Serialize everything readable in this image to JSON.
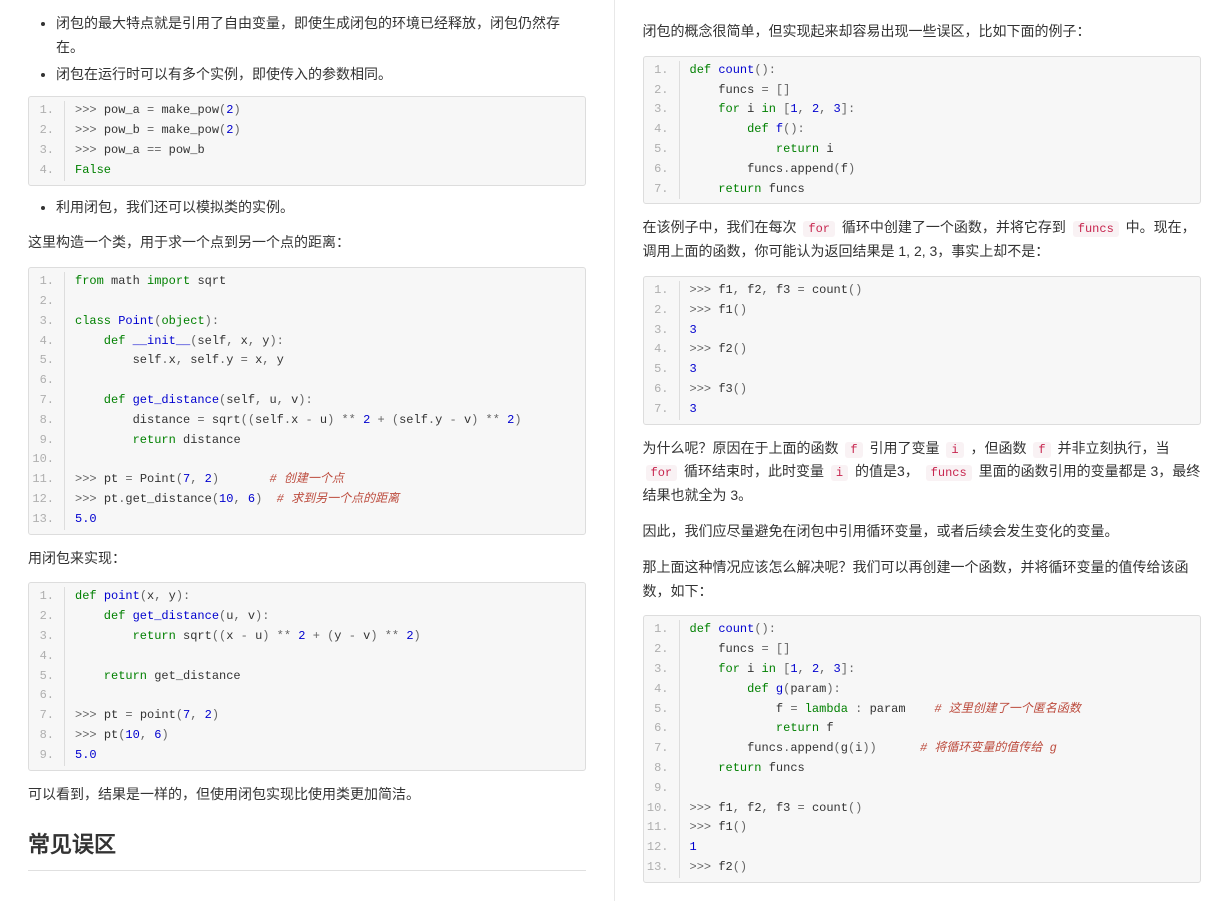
{
  "left": {
    "bullets": [
      "闭包的最大特点就是引用了自由变量，即使生成闭包的环境已经释放，闭包仍然存在。",
      "闭包在运行时可以有多个实例，即使传入的参数相同。"
    ],
    "code1": [
      [
        {
          "t": ">>> ",
          "c": "pr"
        },
        {
          "t": "pow_a ",
          "c": "nm"
        },
        {
          "t": "= ",
          "c": "op"
        },
        {
          "t": "make_pow",
          "c": "nm"
        },
        {
          "t": "(",
          "c": "op"
        },
        {
          "t": "2",
          "c": "num"
        },
        {
          "t": ")",
          "c": "op"
        }
      ],
      [
        {
          "t": ">>> ",
          "c": "pr"
        },
        {
          "t": "pow_b ",
          "c": "nm"
        },
        {
          "t": "= ",
          "c": "op"
        },
        {
          "t": "make_pow",
          "c": "nm"
        },
        {
          "t": "(",
          "c": "op"
        },
        {
          "t": "2",
          "c": "num"
        },
        {
          "t": ")",
          "c": "op"
        }
      ],
      [
        {
          "t": ">>> ",
          "c": "pr"
        },
        {
          "t": "pow_a ",
          "c": "nm"
        },
        {
          "t": "== ",
          "c": "op"
        },
        {
          "t": "pow_b",
          "c": "nm"
        }
      ],
      [
        {
          "t": "False",
          "c": "kw"
        }
      ]
    ],
    "bullets2": [
      "利用闭包，我们还可以模拟类的实例。"
    ],
    "p1": "这里构造一个类，用于求一个点到另一个点的距离：",
    "code2": [
      [
        {
          "t": "from ",
          "c": "kw"
        },
        {
          "t": "math ",
          "c": "nm"
        },
        {
          "t": "import ",
          "c": "kw"
        },
        {
          "t": "sqrt",
          "c": "nm"
        }
      ],
      [
        {
          "t": "",
          "c": "nm"
        }
      ],
      [
        {
          "t": "class ",
          "c": "kw"
        },
        {
          "t": "Point",
          "c": "fn"
        },
        {
          "t": "(",
          "c": "op"
        },
        {
          "t": "object",
          "c": "bi"
        },
        {
          "t": "):",
          "c": "op"
        }
      ],
      [
        {
          "t": "    def ",
          "c": "kw"
        },
        {
          "t": "__init__",
          "c": "fn"
        },
        {
          "t": "(",
          "c": "op"
        },
        {
          "t": "self",
          "c": "nm"
        },
        {
          "t": ", ",
          "c": "op"
        },
        {
          "t": "x",
          "c": "nm"
        },
        {
          "t": ", ",
          "c": "op"
        },
        {
          "t": "y",
          "c": "nm"
        },
        {
          "t": "):",
          "c": "op"
        }
      ],
      [
        {
          "t": "        self",
          "c": "nm"
        },
        {
          "t": ".",
          "c": "op"
        },
        {
          "t": "x",
          "c": "nm"
        },
        {
          "t": ", ",
          "c": "op"
        },
        {
          "t": "self",
          "c": "nm"
        },
        {
          "t": ".",
          "c": "op"
        },
        {
          "t": "y ",
          "c": "nm"
        },
        {
          "t": "= ",
          "c": "op"
        },
        {
          "t": "x",
          "c": "nm"
        },
        {
          "t": ", ",
          "c": "op"
        },
        {
          "t": "y",
          "c": "nm"
        }
      ],
      [
        {
          "t": "",
          "c": "nm"
        }
      ],
      [
        {
          "t": "    def ",
          "c": "kw"
        },
        {
          "t": "get_distance",
          "c": "fn"
        },
        {
          "t": "(",
          "c": "op"
        },
        {
          "t": "self",
          "c": "nm"
        },
        {
          "t": ", ",
          "c": "op"
        },
        {
          "t": "u",
          "c": "nm"
        },
        {
          "t": ", ",
          "c": "op"
        },
        {
          "t": "v",
          "c": "nm"
        },
        {
          "t": "):",
          "c": "op"
        }
      ],
      [
        {
          "t": "        distance ",
          "c": "nm"
        },
        {
          "t": "= ",
          "c": "op"
        },
        {
          "t": "sqrt",
          "c": "nm"
        },
        {
          "t": "((",
          "c": "op"
        },
        {
          "t": "self",
          "c": "nm"
        },
        {
          "t": ".",
          "c": "op"
        },
        {
          "t": "x ",
          "c": "nm"
        },
        {
          "t": "- ",
          "c": "op"
        },
        {
          "t": "u",
          "c": "nm"
        },
        {
          "t": ") ",
          "c": "op"
        },
        {
          "t": "** ",
          "c": "op"
        },
        {
          "t": "2 ",
          "c": "num"
        },
        {
          "t": "+ (",
          "c": "op"
        },
        {
          "t": "self",
          "c": "nm"
        },
        {
          "t": ".",
          "c": "op"
        },
        {
          "t": "y ",
          "c": "nm"
        },
        {
          "t": "- ",
          "c": "op"
        },
        {
          "t": "v",
          "c": "nm"
        },
        {
          "t": ") ",
          "c": "op"
        },
        {
          "t": "** ",
          "c": "op"
        },
        {
          "t": "2",
          "c": "num"
        },
        {
          "t": ")",
          "c": "op"
        }
      ],
      [
        {
          "t": "        return ",
          "c": "kw"
        },
        {
          "t": "distance",
          "c": "nm"
        }
      ],
      [
        {
          "t": "",
          "c": "nm"
        }
      ],
      [
        {
          "t": ">>> ",
          "c": "pr"
        },
        {
          "t": "pt ",
          "c": "nm"
        },
        {
          "t": "= ",
          "c": "op"
        },
        {
          "t": "Point",
          "c": "nm"
        },
        {
          "t": "(",
          "c": "op"
        },
        {
          "t": "7",
          "c": "num"
        },
        {
          "t": ", ",
          "c": "op"
        },
        {
          "t": "2",
          "c": "num"
        },
        {
          "t": ")       ",
          "c": "op"
        },
        {
          "t": "# 创建一个点",
          "c": "cmt"
        }
      ],
      [
        {
          "t": ">>> ",
          "c": "pr"
        },
        {
          "t": "pt",
          "c": "nm"
        },
        {
          "t": ".",
          "c": "op"
        },
        {
          "t": "get_distance",
          "c": "nm"
        },
        {
          "t": "(",
          "c": "op"
        },
        {
          "t": "10",
          "c": "num"
        },
        {
          "t": ", ",
          "c": "op"
        },
        {
          "t": "6",
          "c": "num"
        },
        {
          "t": ")  ",
          "c": "op"
        },
        {
          "t": "# 求到另一个点的距离",
          "c": "cmt"
        }
      ],
      [
        {
          "t": "5.0",
          "c": "num"
        }
      ]
    ],
    "p2": "用闭包来实现：",
    "code3": [
      [
        {
          "t": "def ",
          "c": "kw"
        },
        {
          "t": "point",
          "c": "fn"
        },
        {
          "t": "(",
          "c": "op"
        },
        {
          "t": "x",
          "c": "nm"
        },
        {
          "t": ", ",
          "c": "op"
        },
        {
          "t": "y",
          "c": "nm"
        },
        {
          "t": "):",
          "c": "op"
        }
      ],
      [
        {
          "t": "    def ",
          "c": "kw"
        },
        {
          "t": "get_distance",
          "c": "fn"
        },
        {
          "t": "(",
          "c": "op"
        },
        {
          "t": "u",
          "c": "nm"
        },
        {
          "t": ", ",
          "c": "op"
        },
        {
          "t": "v",
          "c": "nm"
        },
        {
          "t": "):",
          "c": "op"
        }
      ],
      [
        {
          "t": "        return ",
          "c": "kw"
        },
        {
          "t": "sqrt",
          "c": "nm"
        },
        {
          "t": "((",
          "c": "op"
        },
        {
          "t": "x ",
          "c": "nm"
        },
        {
          "t": "- ",
          "c": "op"
        },
        {
          "t": "u",
          "c": "nm"
        },
        {
          "t": ") ",
          "c": "op"
        },
        {
          "t": "** ",
          "c": "op"
        },
        {
          "t": "2 ",
          "c": "num"
        },
        {
          "t": "+ (",
          "c": "op"
        },
        {
          "t": "y ",
          "c": "nm"
        },
        {
          "t": "- ",
          "c": "op"
        },
        {
          "t": "v",
          "c": "nm"
        },
        {
          "t": ") ",
          "c": "op"
        },
        {
          "t": "** ",
          "c": "op"
        },
        {
          "t": "2",
          "c": "num"
        },
        {
          "t": ")",
          "c": "op"
        }
      ],
      [
        {
          "t": "",
          "c": "nm"
        }
      ],
      [
        {
          "t": "    return ",
          "c": "kw"
        },
        {
          "t": "get_distance",
          "c": "nm"
        }
      ],
      [
        {
          "t": "",
          "c": "nm"
        }
      ],
      [
        {
          "t": ">>> ",
          "c": "pr"
        },
        {
          "t": "pt ",
          "c": "nm"
        },
        {
          "t": "= ",
          "c": "op"
        },
        {
          "t": "point",
          "c": "nm"
        },
        {
          "t": "(",
          "c": "op"
        },
        {
          "t": "7",
          "c": "num"
        },
        {
          "t": ", ",
          "c": "op"
        },
        {
          "t": "2",
          "c": "num"
        },
        {
          "t": ")",
          "c": "op"
        }
      ],
      [
        {
          "t": ">>> ",
          "c": "pr"
        },
        {
          "t": "pt",
          "c": "nm"
        },
        {
          "t": "(",
          "c": "op"
        },
        {
          "t": "10",
          "c": "num"
        },
        {
          "t": ", ",
          "c": "op"
        },
        {
          "t": "6",
          "c": "num"
        },
        {
          "t": ")",
          "c": "op"
        }
      ],
      [
        {
          "t": "5.0",
          "c": "num"
        }
      ]
    ],
    "p3": "可以看到，结果是一样的，但使用闭包实现比使用类更加简洁。",
    "h2": "常见误区"
  },
  "right": {
    "p1": "闭包的概念很简单，但实现起来却容易出现一些误区，比如下面的例子：",
    "code1": [
      [
        {
          "t": "def ",
          "c": "kw"
        },
        {
          "t": "count",
          "c": "fn"
        },
        {
          "t": "():",
          "c": "op"
        }
      ],
      [
        {
          "t": "    funcs ",
          "c": "nm"
        },
        {
          "t": "= []",
          "c": "op"
        }
      ],
      [
        {
          "t": "    for ",
          "c": "kw"
        },
        {
          "t": "i ",
          "c": "nm"
        },
        {
          "t": "in ",
          "c": "kw"
        },
        {
          "t": "[",
          "c": "op"
        },
        {
          "t": "1",
          "c": "num"
        },
        {
          "t": ", ",
          "c": "op"
        },
        {
          "t": "2",
          "c": "num"
        },
        {
          "t": ", ",
          "c": "op"
        },
        {
          "t": "3",
          "c": "num"
        },
        {
          "t": "]:",
          "c": "op"
        }
      ],
      [
        {
          "t": "        def ",
          "c": "kw"
        },
        {
          "t": "f",
          "c": "fn"
        },
        {
          "t": "():",
          "c": "op"
        }
      ],
      [
        {
          "t": "            return ",
          "c": "kw"
        },
        {
          "t": "i",
          "c": "nm"
        }
      ],
      [
        {
          "t": "        funcs",
          "c": "nm"
        },
        {
          "t": ".",
          "c": "op"
        },
        {
          "t": "append",
          "c": "nm"
        },
        {
          "t": "(",
          "c": "op"
        },
        {
          "t": "f",
          "c": "nm"
        },
        {
          "t": ")",
          "c": "op"
        }
      ],
      [
        {
          "t": "    return ",
          "c": "kw"
        },
        {
          "t": "funcs",
          "c": "nm"
        }
      ]
    ],
    "p2_parts": {
      "a": "在该例子中，我们在每次 ",
      "b": " 循环中创建了一个函数，并将它存到 ",
      "c": " 中。现在，调用上面的函数，你可能认为返回结果是 1, 2, 3，事实上却不是："
    },
    "ic_for": "for",
    "ic_funcs": "funcs",
    "code2": [
      [
        {
          "t": ">>> ",
          "c": "pr"
        },
        {
          "t": "f1",
          "c": "nm"
        },
        {
          "t": ", ",
          "c": "op"
        },
        {
          "t": "f2",
          "c": "nm"
        },
        {
          "t": ", ",
          "c": "op"
        },
        {
          "t": "f3 ",
          "c": "nm"
        },
        {
          "t": "= ",
          "c": "op"
        },
        {
          "t": "count",
          "c": "nm"
        },
        {
          "t": "()",
          "c": "op"
        }
      ],
      [
        {
          "t": ">>> ",
          "c": "pr"
        },
        {
          "t": "f1",
          "c": "nm"
        },
        {
          "t": "()",
          "c": "op"
        }
      ],
      [
        {
          "t": "3",
          "c": "num"
        }
      ],
      [
        {
          "t": ">>> ",
          "c": "pr"
        },
        {
          "t": "f2",
          "c": "nm"
        },
        {
          "t": "()",
          "c": "op"
        }
      ],
      [
        {
          "t": "3",
          "c": "num"
        }
      ],
      [
        {
          "t": ">>> ",
          "c": "pr"
        },
        {
          "t": "f3",
          "c": "nm"
        },
        {
          "t": "()",
          "c": "op"
        }
      ],
      [
        {
          "t": "3",
          "c": "num"
        }
      ]
    ],
    "p3_parts": {
      "a": "为什么呢？原因在于上面的函数 ",
      "b": " 引用了变量 ",
      "c": " ，但函数 ",
      "d": " 并非立刻执行，当 ",
      "e": " 循环结束时，此时变量 ",
      "f2": " 的值是3， ",
      "g": " 里面的函数引用的变量都是 3，最终结果也就全为 3。"
    },
    "ic_f": "f",
    "ic_i": "i",
    "p4": "因此，我们应尽量避免在闭包中引用循环变量，或者后续会发生变化的变量。",
    "p5": "那上面这种情况应该怎么解决呢？我们可以再创建一个函数，并将循环变量的值传给该函数，如下：",
    "code3": [
      [
        {
          "t": "def ",
          "c": "kw"
        },
        {
          "t": "count",
          "c": "fn"
        },
        {
          "t": "():",
          "c": "op"
        }
      ],
      [
        {
          "t": "    funcs ",
          "c": "nm"
        },
        {
          "t": "= []",
          "c": "op"
        }
      ],
      [
        {
          "t": "    for ",
          "c": "kw"
        },
        {
          "t": "i ",
          "c": "nm"
        },
        {
          "t": "in ",
          "c": "kw"
        },
        {
          "t": "[",
          "c": "op"
        },
        {
          "t": "1",
          "c": "num"
        },
        {
          "t": ", ",
          "c": "op"
        },
        {
          "t": "2",
          "c": "num"
        },
        {
          "t": ", ",
          "c": "op"
        },
        {
          "t": "3",
          "c": "num"
        },
        {
          "t": "]:",
          "c": "op"
        }
      ],
      [
        {
          "t": "        def ",
          "c": "kw"
        },
        {
          "t": "g",
          "c": "fn"
        },
        {
          "t": "(",
          "c": "op"
        },
        {
          "t": "param",
          "c": "nm"
        },
        {
          "t": "):",
          "c": "op"
        }
      ],
      [
        {
          "t": "            f ",
          "c": "nm"
        },
        {
          "t": "= ",
          "c": "op"
        },
        {
          "t": "lambda ",
          "c": "kw"
        },
        {
          "t": ": ",
          "c": "op"
        },
        {
          "t": "param    ",
          "c": "nm"
        },
        {
          "t": "# 这里创建了一个匿名函数",
          "c": "cmt"
        }
      ],
      [
        {
          "t": "            return ",
          "c": "kw"
        },
        {
          "t": "f",
          "c": "nm"
        }
      ],
      [
        {
          "t": "        funcs",
          "c": "nm"
        },
        {
          "t": ".",
          "c": "op"
        },
        {
          "t": "append",
          "c": "nm"
        },
        {
          "t": "(",
          "c": "op"
        },
        {
          "t": "g",
          "c": "nm"
        },
        {
          "t": "(",
          "c": "op"
        },
        {
          "t": "i",
          "c": "nm"
        },
        {
          "t": "))      ",
          "c": "op"
        },
        {
          "t": "# 将循环变量的值传给 g",
          "c": "cmt"
        }
      ],
      [
        {
          "t": "    return ",
          "c": "kw"
        },
        {
          "t": "funcs",
          "c": "nm"
        }
      ],
      [
        {
          "t": "",
          "c": "nm"
        }
      ],
      [
        {
          "t": ">>> ",
          "c": "pr"
        },
        {
          "t": "f1",
          "c": "nm"
        },
        {
          "t": ", ",
          "c": "op"
        },
        {
          "t": "f2",
          "c": "nm"
        },
        {
          "t": ", ",
          "c": "op"
        },
        {
          "t": "f3 ",
          "c": "nm"
        },
        {
          "t": "= ",
          "c": "op"
        },
        {
          "t": "count",
          "c": "nm"
        },
        {
          "t": "()",
          "c": "op"
        }
      ],
      [
        {
          "t": ">>> ",
          "c": "pr"
        },
        {
          "t": "f1",
          "c": "nm"
        },
        {
          "t": "()",
          "c": "op"
        }
      ],
      [
        {
          "t": "1",
          "c": "num"
        }
      ],
      [
        {
          "t": ">>> ",
          "c": "pr"
        },
        {
          "t": "f2",
          "c": "nm"
        },
        {
          "t": "()",
          "c": "op"
        }
      ]
    ]
  }
}
